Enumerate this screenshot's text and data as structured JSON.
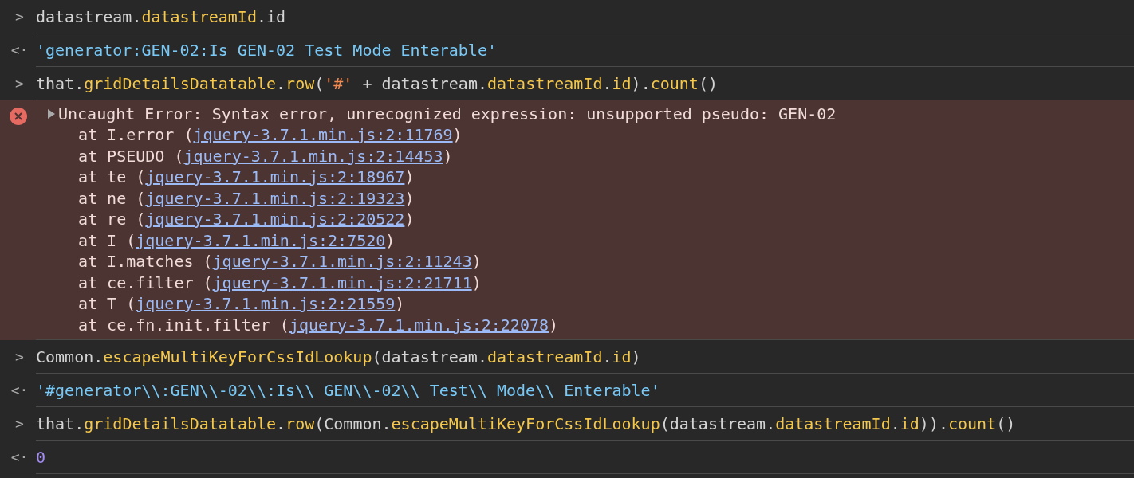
{
  "entries": [
    {
      "kind": "input",
      "prompt": ">",
      "tokens": [
        {
          "kind": "plain",
          "text": "datastream."
        },
        {
          "kind": "prop",
          "text": "datastreamId"
        },
        {
          "kind": "plain",
          "text": ".id"
        }
      ]
    },
    {
      "kind": "result",
      "prompt": "<·",
      "value": {
        "kind": "string",
        "text": "'generator:GEN-02:Is GEN-02 Test Mode Enterable'"
      }
    },
    {
      "kind": "input",
      "prompt": ">",
      "tokens": [
        {
          "kind": "plain",
          "text": "that."
        },
        {
          "kind": "prop",
          "text": "gridDetailsDatatable"
        },
        {
          "kind": "plain",
          "text": "."
        },
        {
          "kind": "prop",
          "text": "row"
        },
        {
          "kind": "plain",
          "text": "("
        },
        {
          "kind": "string",
          "text": "'#'"
        },
        {
          "kind": "plain",
          "text": " + datastream."
        },
        {
          "kind": "prop",
          "text": "datastreamId"
        },
        {
          "kind": "plain",
          "text": "."
        },
        {
          "kind": "prop",
          "text": "id"
        },
        {
          "kind": "plain",
          "text": ")."
        },
        {
          "kind": "prop",
          "text": "count"
        },
        {
          "kind": "plain",
          "text": "()"
        }
      ]
    },
    {
      "kind": "error",
      "expanded": false,
      "message": "Uncaught Error: Syntax error, unrecognized expression: unsupported pseudo: GEN-02",
      "frames": [
        {
          "at": "at I.error (",
          "link": "jquery-3.7.1.min.js:2:11769",
          "end": ")"
        },
        {
          "at": "at PSEUDO (",
          "link": "jquery-3.7.1.min.js:2:14453",
          "end": ")"
        },
        {
          "at": "at te (",
          "link": "jquery-3.7.1.min.js:2:18967",
          "end": ")"
        },
        {
          "at": "at ne (",
          "link": "jquery-3.7.1.min.js:2:19323",
          "end": ")"
        },
        {
          "at": "at re (",
          "link": "jquery-3.7.1.min.js:2:20522",
          "end": ")"
        },
        {
          "at": "at I (",
          "link": "jquery-3.7.1.min.js:2:7520",
          "end": ")"
        },
        {
          "at": "at I.matches (",
          "link": "jquery-3.7.1.min.js:2:11243",
          "end": ")"
        },
        {
          "at": "at ce.filter (",
          "link": "jquery-3.7.1.min.js:2:21711",
          "end": ")"
        },
        {
          "at": "at T (",
          "link": "jquery-3.7.1.min.js:2:21559",
          "end": ")"
        },
        {
          "at": "at ce.fn.init.filter (",
          "link": "jquery-3.7.1.min.js:2:22078",
          "end": ")"
        }
      ]
    },
    {
      "kind": "input",
      "prompt": ">",
      "tokens": [
        {
          "kind": "plain",
          "text": "Common."
        },
        {
          "kind": "prop",
          "text": "escapeMultiKeyForCssIdLookup"
        },
        {
          "kind": "plain",
          "text": "(datastream."
        },
        {
          "kind": "prop",
          "text": "datastreamId"
        },
        {
          "kind": "plain",
          "text": "."
        },
        {
          "kind": "prop",
          "text": "id"
        },
        {
          "kind": "plain",
          "text": ")"
        }
      ]
    },
    {
      "kind": "result",
      "prompt": "<·",
      "value": {
        "kind": "string",
        "text": "'#generator\\\\:GEN\\\\-02\\\\:Is\\\\ GEN\\\\-02\\\\ Test\\\\ Mode\\\\ Enterable'"
      }
    },
    {
      "kind": "input",
      "prompt": ">",
      "tokens": [
        {
          "kind": "plain",
          "text": "that."
        },
        {
          "kind": "prop",
          "text": "gridDetailsDatatable"
        },
        {
          "kind": "plain",
          "text": "."
        },
        {
          "kind": "prop",
          "text": "row"
        },
        {
          "kind": "plain",
          "text": "(Common."
        },
        {
          "kind": "prop",
          "text": "escapeMultiKeyForCssIdLookup"
        },
        {
          "kind": "plain",
          "text": "(datastream."
        },
        {
          "kind": "prop",
          "text": "datastreamId"
        },
        {
          "kind": "plain",
          "text": "."
        },
        {
          "kind": "prop",
          "text": "id"
        },
        {
          "kind": "plain",
          "text": "))."
        },
        {
          "kind": "prop",
          "text": "count"
        },
        {
          "kind": "plain",
          "text": "()"
        }
      ]
    },
    {
      "kind": "result",
      "prompt": "<·",
      "value": {
        "kind": "number",
        "text": "0"
      }
    }
  ]
}
